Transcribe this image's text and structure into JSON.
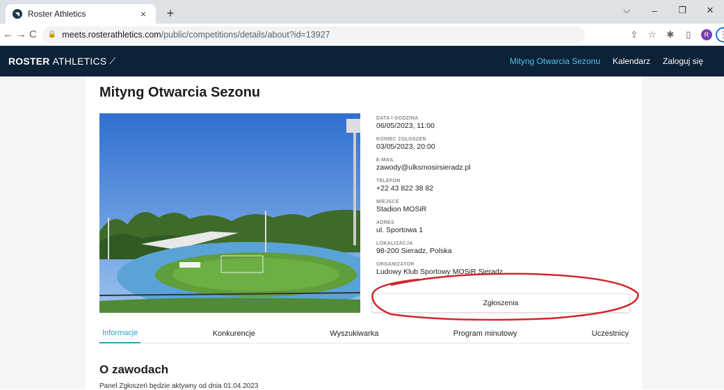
{
  "browser": {
    "tab_title": "Roster Athletics",
    "tab_close": "×",
    "new_tab": "+",
    "url_host": "meets.rosterathletics.com",
    "url_path": "/public/competitions/details/about?id=13927",
    "profile_initial": "R",
    "window_controls": [
      "⌵",
      "–",
      "❐",
      "✕"
    ]
  },
  "site": {
    "logo_bold": "ROSTER",
    "logo_thin": "ATHLETICS",
    "nav": [
      "Mityng Otwarcia Sezonu",
      "Kalendarz",
      "Zaloguj się"
    ]
  },
  "event": {
    "title": "Mityng Otwarcia Sezonu",
    "details": [
      {
        "label": "DATA I GODZINA",
        "value": "06/05/2023, 11:00"
      },
      {
        "label": "KONIEC ZGŁOSZEŃ",
        "value": "03/05/2023, 20:00"
      },
      {
        "label": "E-MAIL",
        "value": "zawody@ulksmosirsieradz.pl"
      },
      {
        "label": "TELEFON",
        "value": "+22 43 822 38 82"
      },
      {
        "label": "MIEJSCE",
        "value": "Stadion MOSiR"
      },
      {
        "label": "ADRES",
        "value": "ul. Sportowa 1"
      },
      {
        "label": "LOKALIZACJA",
        "value": "98-200 Sieradz, Polska"
      },
      {
        "label": "ORGANIZATOR",
        "value": "Ludowy Klub Sportowy MOSiR Sieradz"
      }
    ],
    "apply_button": "Zgłoszenia"
  },
  "tabs": [
    "Informacje",
    "Konkurencje",
    "Wyszukiwarka",
    "Program minutowy",
    "Uczestnicy"
  ],
  "about": {
    "title": "O zawodach",
    "text": "Panel Zgłoszeń będzie aktywny od dnia 01.04.2023"
  },
  "colors": {
    "header_bg": "#0d2137",
    "accent": "#27a3c7",
    "annotation": "#d0262b"
  }
}
